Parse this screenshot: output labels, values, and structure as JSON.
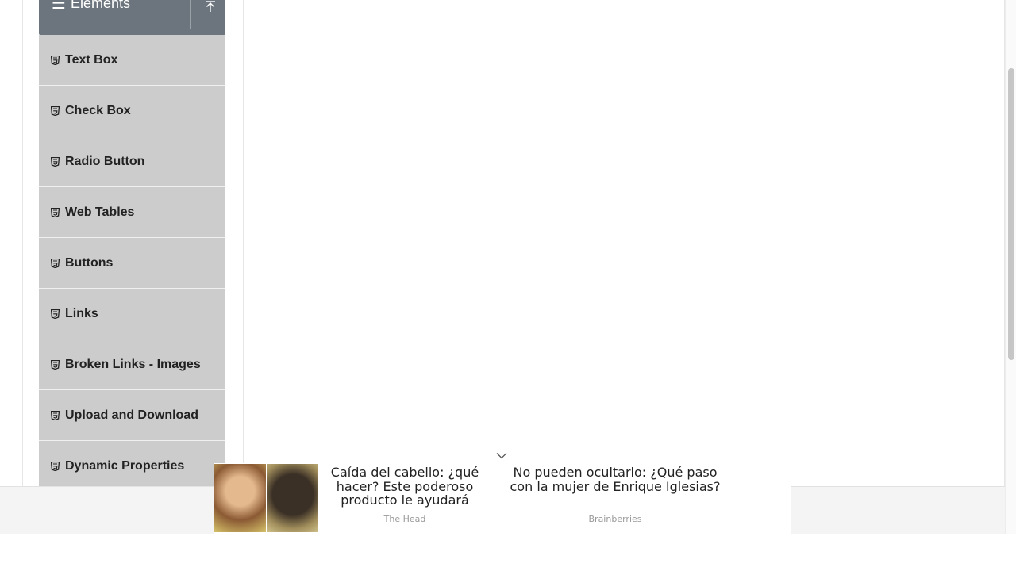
{
  "sidebar": {
    "group_title": "Elements",
    "group_icon": "menu-icon",
    "collapse_icon": "collapse-up-icon",
    "header_color": "#6c757d",
    "item_color": "#cccccc",
    "items": [
      {
        "label": "Text Box",
        "icon": "html5-icon"
      },
      {
        "label": "Check Box",
        "icon": "html5-icon"
      },
      {
        "label": "Radio Button",
        "icon": "html5-icon"
      },
      {
        "label": "Web Tables",
        "icon": "html5-icon"
      },
      {
        "label": "Buttons",
        "icon": "html5-icon"
      },
      {
        "label": "Links",
        "icon": "html5-icon"
      },
      {
        "label": "Broken Links - Images",
        "icon": "html5-icon"
      },
      {
        "label": "Upload and Download",
        "icon": "html5-icon"
      },
      {
        "label": "Dynamic Properties",
        "icon": "html5-icon"
      }
    ]
  },
  "ad": {
    "close_icon": "chevron-down-icon",
    "cards": [
      {
        "headline": "Caída del cabello: ¿qué hacer? Este poderoso producto le ayudará",
        "source": "The Head"
      },
      {
        "headline": "No pueden ocultarlo: ¿Qué paso con la mujer de Enrique Iglesias?",
        "source": "Brainberries"
      }
    ]
  }
}
